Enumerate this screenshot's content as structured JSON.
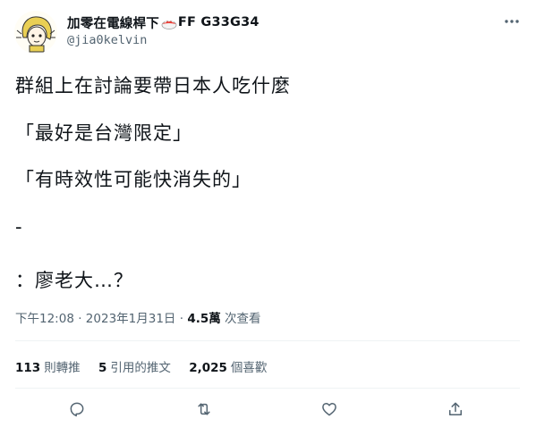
{
  "author": {
    "display_name": "加零在電線桿下",
    "display_name_suffix": "FF G33G34",
    "handle": "@jia0kelvin",
    "avatar_icon": "cartoon-girl-avatar-icon",
    "badge_icon": "sushi-emoji-icon"
  },
  "tweet": {
    "lines": [
      "群組上在討論要帶日本人吃什麼",
      "「最好是台灣限定」",
      "「有時效性可能快消失的」",
      "-",
      "：廖老大…？"
    ]
  },
  "meta": {
    "time": "下午12:08",
    "sep1": "·",
    "date": "2023年1月31日",
    "sep2": "·",
    "views_count": "4.5萬",
    "views_label": "次查看"
  },
  "stats": {
    "retweets_count": "113",
    "retweets_label": "則轉推",
    "quotes_count": "5",
    "quotes_label": "引用的推文",
    "likes_count": "2,025",
    "likes_label": "個喜歡"
  },
  "actions": {
    "reply_icon": "reply-icon",
    "retweet_icon": "retweet-icon",
    "like_icon": "heart-icon",
    "share_icon": "share-icon",
    "more_icon": "more-options-icon"
  },
  "colors": {
    "text_primary": "#0f1419",
    "text_secondary": "#536471",
    "divider": "#eff3f4"
  }
}
